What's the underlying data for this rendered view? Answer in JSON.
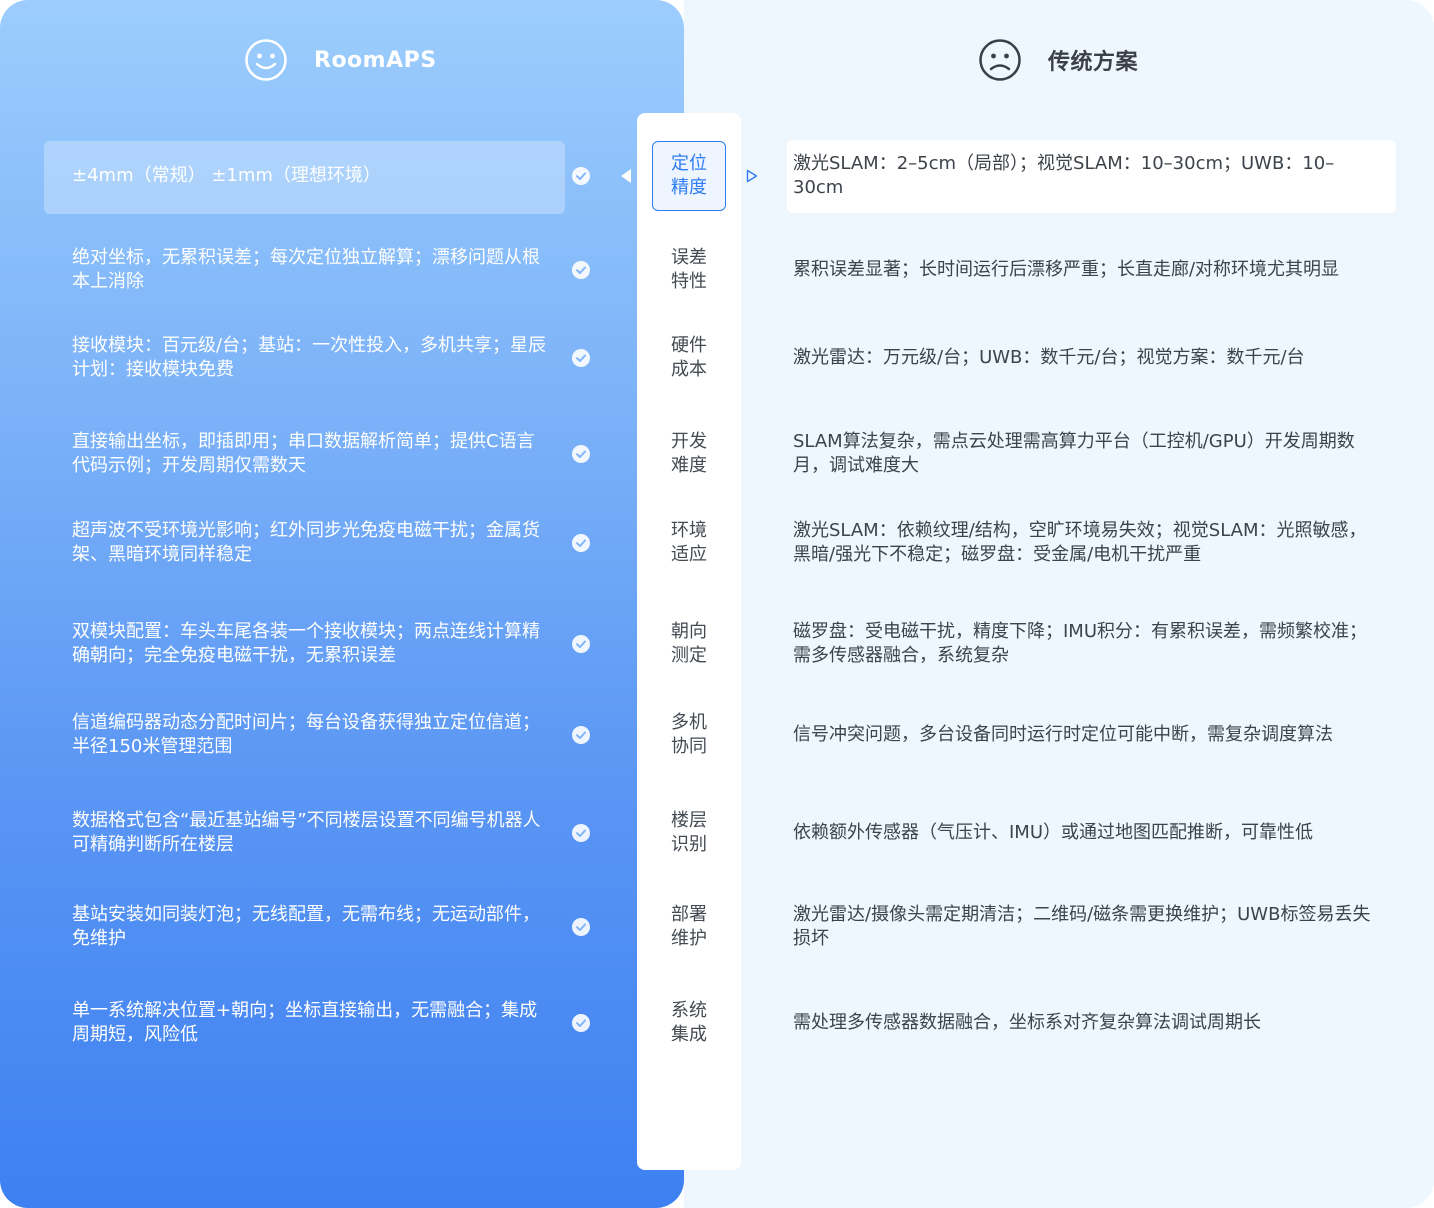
{
  "colors": {
    "accent": "#2f7df3",
    "left_panel_top": "#9ccdfd",
    "left_panel_bottom": "#3d80f1",
    "right_panel_bg": "#eef6fe"
  },
  "header": {
    "left": {
      "icon": "smiley-face-icon",
      "title": "RoomAPS"
    },
    "right": {
      "icon": "sad-face-icon",
      "title": "传统方案"
    }
  },
  "rows": [
    {
      "label_line1": "定位",
      "label_line2": "精度",
      "active": true,
      "roomaps": "±4mm（常规） ±1mm（理想环境）",
      "traditional": "激光SLAM：2–5cm（局部）；视觉SLAM：10–30cm；UWB：10–30cm"
    },
    {
      "label_line1": "误差",
      "label_line2": "特性",
      "roomaps": "绝对坐标，无累积误差；每次定位独立解算；漂移问题从根本上消除",
      "traditional": "累积误差显著；长时间运行后漂移严重；长直走廊/对称环境尤其明显"
    },
    {
      "label_line1": "硬件",
      "label_line2": "成本",
      "roomaps": "接收模块：百元级/台；基站：一次性投入，多机共享；星辰计划：接收模块免费",
      "traditional": "激光雷达：万元级/台；UWB：数千元/台；视觉方案：数千元/台"
    },
    {
      "label_line1": "开发",
      "label_line2": "难度",
      "roomaps": "直接输出坐标，即插即用；串口数据解析简单；提供C语言代码示例；开发周期仅需数天",
      "traditional": "SLAM算法复杂，需点云处理需高算力平台（工控机/GPU）开发周期数月，调试难度大"
    },
    {
      "label_line1": "环境",
      "label_line2": "适应",
      "roomaps": "超声波不受环境光影响；红外同步光免疫电磁干扰；金属货架、黑暗环境同样稳定",
      "traditional": "激光SLAM：依赖纹理/结构，空旷环境易失效；视觉SLAM：光照敏感，黑暗/强光下不稳定；磁罗盘：受金属/电机干扰严重"
    },
    {
      "label_line1": "朝向",
      "label_line2": "测定",
      "roomaps": "双模块配置：车头车尾各装一个接收模块；两点连线计算精确朝向；完全免疫电磁干扰，无累积误差",
      "traditional": "磁罗盘：受电磁干扰，精度下降；IMU积分：有累积误差，需频繁校准；需多传感器融合，系统复杂"
    },
    {
      "label_line1": "多机",
      "label_line2": "协同",
      "roomaps": "信道编码器动态分配时间片；每台设备获得独立定位信道；半径150米管理范围",
      "traditional": "信号冲突问题，多台设备同时运行时定位可能中断，需复杂调度算法"
    },
    {
      "label_line1": "楼层",
      "label_line2": "识别",
      "roomaps": "数据格式包含“最近基站编号”不同楼层设置不同编号机器人可精确判断所在楼层",
      "traditional": "依赖额外传感器（气压计、IMU）或通过地图匹配推断，可靠性低"
    },
    {
      "label_line1": "部署",
      "label_line2": "维护",
      "roomaps": "基站安装如同装灯泡；无线配置，无需布线；无运动部件，免维护",
      "traditional": "激光雷达/摄像头需定期清洁；二维码/磁条需更换维护；UWB标签易丢失损坏"
    },
    {
      "label_line1": "系统",
      "label_line2": "集成",
      "roomaps": "单一系统解决位置+朝向；坐标直接输出，无需融合；集成周期短，风险低",
      "traditional": "需处理多传感器数据融合，坐标系对齐复杂算法调试周期长"
    }
  ]
}
